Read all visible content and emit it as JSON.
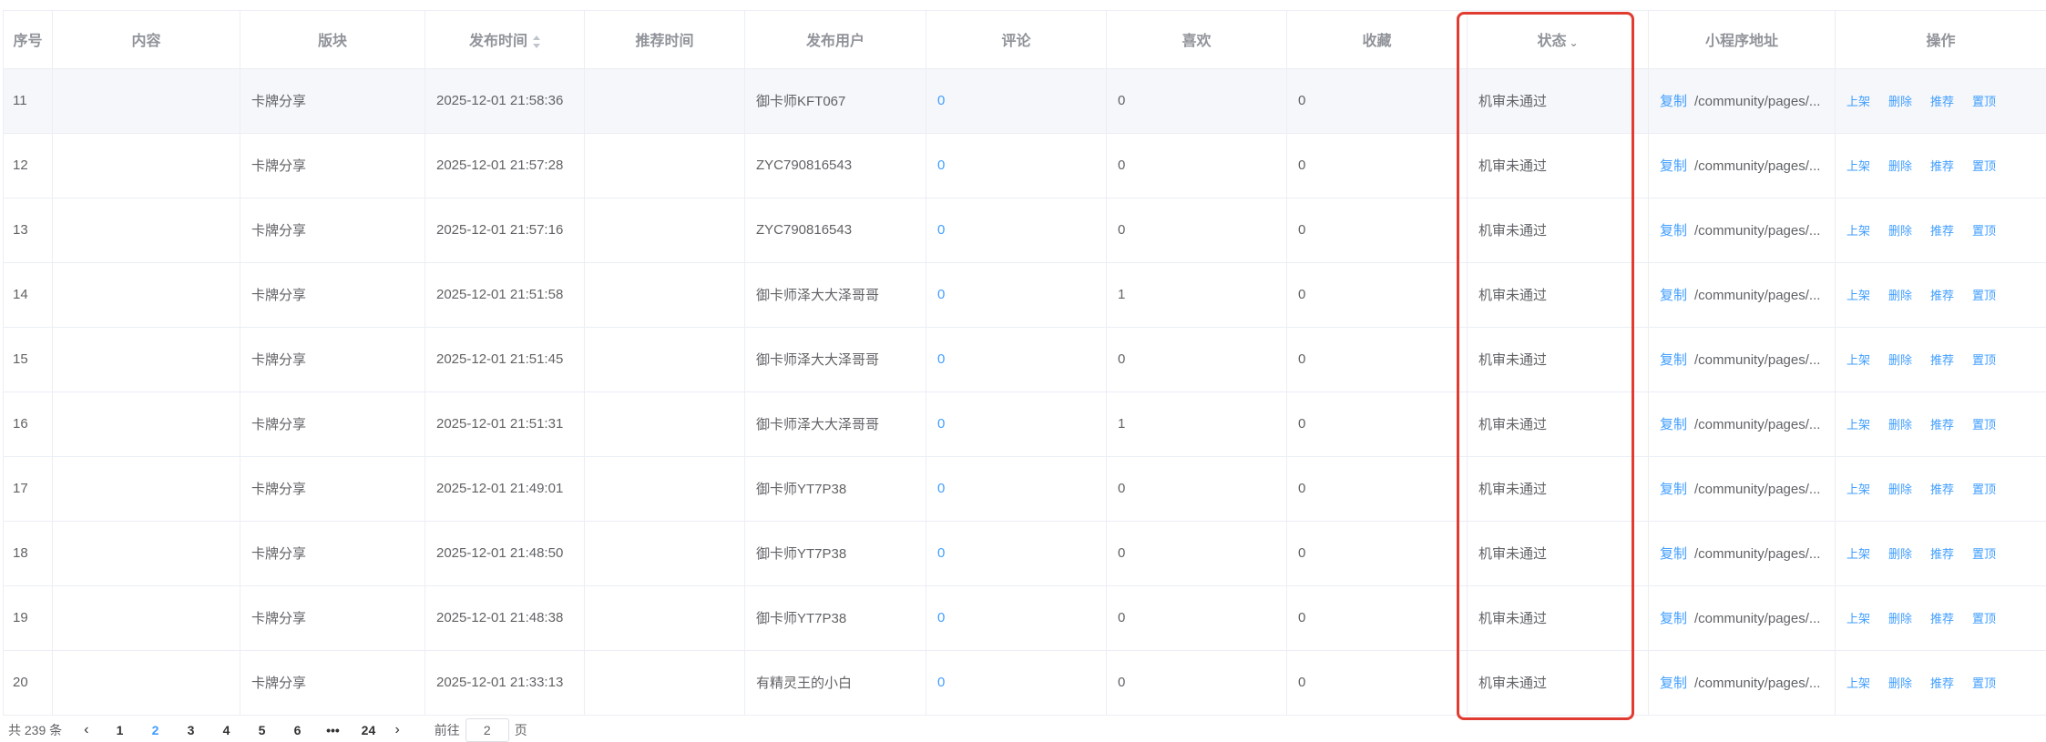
{
  "table": {
    "headers": {
      "index": "序号",
      "content": "内容",
      "section": "版块",
      "publish_time": "发布时间",
      "recommend_time": "推荐时间",
      "publisher": "发布用户",
      "comments": "评论",
      "likes": "喜欢",
      "favorites": "收藏",
      "status": "状态",
      "miniprogram_path": "小程序地址",
      "actions": "操作"
    },
    "rows": [
      {
        "index": "11",
        "content": "",
        "section": "卡牌分享",
        "publish_time": "2025-12-01 21:58:36",
        "recommend_time": "",
        "publisher": "御卡师KFT067",
        "comments": "0",
        "likes": "0",
        "favorites": "0",
        "status": "机审未通过",
        "copy": "复制",
        "path": "/community/pages/...",
        "actions": {
          "shelve": "上架",
          "delete": "删除",
          "recommend": "推荐",
          "pin": "置顶"
        }
      },
      {
        "index": "12",
        "content": "",
        "section": "卡牌分享",
        "publish_time": "2025-12-01 21:57:28",
        "recommend_time": "",
        "publisher": "ZYC790816543",
        "comments": "0",
        "likes": "0",
        "favorites": "0",
        "status": "机审未通过",
        "copy": "复制",
        "path": "/community/pages/...",
        "actions": {
          "shelve": "上架",
          "delete": "删除",
          "recommend": "推荐",
          "pin": "置顶"
        }
      },
      {
        "index": "13",
        "content": "",
        "section": "卡牌分享",
        "publish_time": "2025-12-01 21:57:16",
        "recommend_time": "",
        "publisher": "ZYC790816543",
        "comments": "0",
        "likes": "0",
        "favorites": "0",
        "status": "机审未通过",
        "copy": "复制",
        "path": "/community/pages/...",
        "actions": {
          "shelve": "上架",
          "delete": "删除",
          "recommend": "推荐",
          "pin": "置顶"
        }
      },
      {
        "index": "14",
        "content": "",
        "section": "卡牌分享",
        "publish_time": "2025-12-01 21:51:58",
        "recommend_time": "",
        "publisher": "御卡师泽大大泽哥哥",
        "comments": "0",
        "likes": "1",
        "favorites": "0",
        "status": "机审未通过",
        "copy": "复制",
        "path": "/community/pages/...",
        "actions": {
          "shelve": "上架",
          "delete": "删除",
          "recommend": "推荐",
          "pin": "置顶"
        }
      },
      {
        "index": "15",
        "content": "",
        "section": "卡牌分享",
        "publish_time": "2025-12-01 21:51:45",
        "recommend_time": "",
        "publisher": "御卡师泽大大泽哥哥",
        "comments": "0",
        "likes": "0",
        "favorites": "0",
        "status": "机审未通过",
        "copy": "复制",
        "path": "/community/pages/...",
        "actions": {
          "shelve": "上架",
          "delete": "删除",
          "recommend": "推荐",
          "pin": "置顶"
        }
      },
      {
        "index": "16",
        "content": "",
        "section": "卡牌分享",
        "publish_time": "2025-12-01 21:51:31",
        "recommend_time": "",
        "publisher": "御卡师泽大大泽哥哥",
        "comments": "0",
        "likes": "1",
        "favorites": "0",
        "status": "机审未通过",
        "copy": "复制",
        "path": "/community/pages/...",
        "actions": {
          "shelve": "上架",
          "delete": "删除",
          "recommend": "推荐",
          "pin": "置顶"
        }
      },
      {
        "index": "17",
        "content": "",
        "section": "卡牌分享",
        "publish_time": "2025-12-01 21:49:01",
        "recommend_time": "",
        "publisher": "御卡师YT7P38",
        "comments": "0",
        "likes": "0",
        "favorites": "0",
        "status": "机审未通过",
        "copy": "复制",
        "path": "/community/pages/...",
        "actions": {
          "shelve": "上架",
          "delete": "删除",
          "recommend": "推荐",
          "pin": "置顶"
        }
      },
      {
        "index": "18",
        "content": "",
        "section": "卡牌分享",
        "publish_time": "2025-12-01 21:48:50",
        "recommend_time": "",
        "publisher": "御卡师YT7P38",
        "comments": "0",
        "likes": "0",
        "favorites": "0",
        "status": "机审未通过",
        "copy": "复制",
        "path": "/community/pages/...",
        "actions": {
          "shelve": "上架",
          "delete": "删除",
          "recommend": "推荐",
          "pin": "置顶"
        }
      },
      {
        "index": "19",
        "content": "",
        "section": "卡牌分享",
        "publish_time": "2025-12-01 21:48:38",
        "recommend_time": "",
        "publisher": "御卡师YT7P38",
        "comments": "0",
        "likes": "0",
        "favorites": "0",
        "status": "机审未通过",
        "copy": "复制",
        "path": "/community/pages/...",
        "actions": {
          "shelve": "上架",
          "delete": "删除",
          "recommend": "推荐",
          "pin": "置顶"
        }
      },
      {
        "index": "20",
        "content": "",
        "section": "卡牌分享",
        "publish_time": "2025-12-01 21:33:13",
        "recommend_time": "",
        "publisher": "有精灵王的小白",
        "comments": "0",
        "likes": "0",
        "favorites": "0",
        "status": "机审未通过",
        "copy": "复制",
        "path": "/community/pages/...",
        "actions": {
          "shelve": "上架",
          "delete": "删除",
          "recommend": "推荐",
          "pin": "置顶"
        }
      }
    ]
  },
  "pagination": {
    "total_label": "共 239 条",
    "prev_icon": "chevron-left-icon",
    "next_icon": "chevron-right-icon",
    "pages": [
      "1",
      "2",
      "3",
      "4",
      "5",
      "6",
      "•••",
      "24"
    ],
    "current_page": "2",
    "jump_prefix": "前往",
    "jump_value": "2",
    "jump_suffix": "页"
  },
  "colors": {
    "link": "#409eff",
    "highlight_border": "#e03c31",
    "header_text": "#909399",
    "cell_text": "#606266",
    "border": "#ebeef5"
  }
}
